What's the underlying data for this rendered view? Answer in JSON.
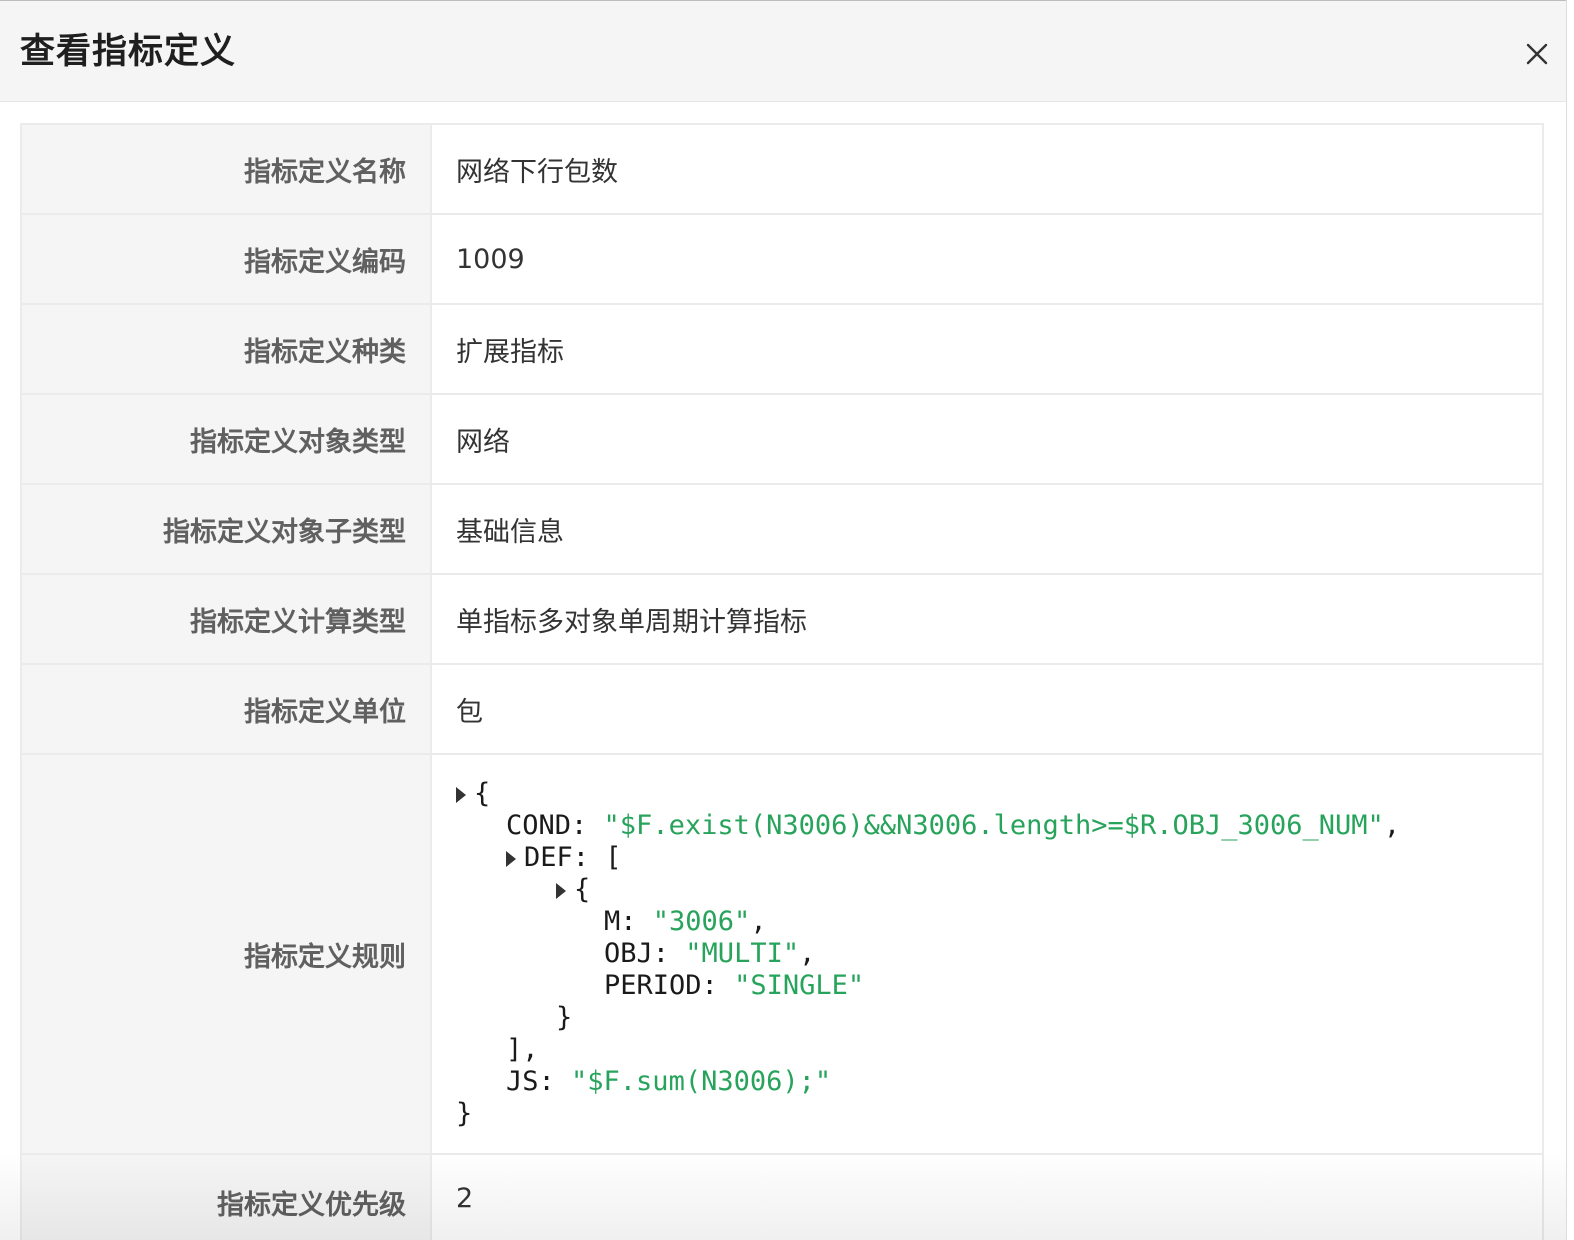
{
  "dialog": {
    "title": "查看指标定义"
  },
  "fields": [
    {
      "label": "指标定义名称",
      "value": "网络下行包数"
    },
    {
      "label": "指标定义编码",
      "value": "1009"
    },
    {
      "label": "指标定义种类",
      "value": "扩展指标"
    },
    {
      "label": "指标定义对象类型",
      "value": "网络"
    },
    {
      "label": "指标定义对象子类型",
      "value": "基础信息"
    },
    {
      "label": "指标定义计算类型",
      "value": "单指标多对象单周期计算指标"
    },
    {
      "label": "指标定义单位",
      "value": "包"
    }
  ],
  "rule": {
    "label": "指标定义规则",
    "json": {
      "open_brace": "{",
      "cond_key": "COND",
      "cond_value": "\"$F.exist(N3006)&&N3006.length>=$R.OBJ_3006_NUM\"",
      "def_key": "DEF",
      "def_open": "[",
      "item_open": "{",
      "m_key": "M",
      "m_value": "\"3006\"",
      "obj_key": "OBJ",
      "obj_value": "\"MULTI\"",
      "period_key": "PERIOD",
      "period_value": "\"SINGLE\"",
      "item_close": "}",
      "def_close": "],",
      "js_key": "JS",
      "js_value": "\"$F.sum(N3006);\"",
      "close_brace": "}"
    }
  },
  "priority": {
    "label": "指标定义优先级",
    "value": "2"
  },
  "colors": {
    "string_value": "#27a35b",
    "label_bg": "#f5f5f5",
    "border": "#ebebeb"
  },
  "icons": {
    "close": "close-icon",
    "expand": "caret-right-icon"
  }
}
